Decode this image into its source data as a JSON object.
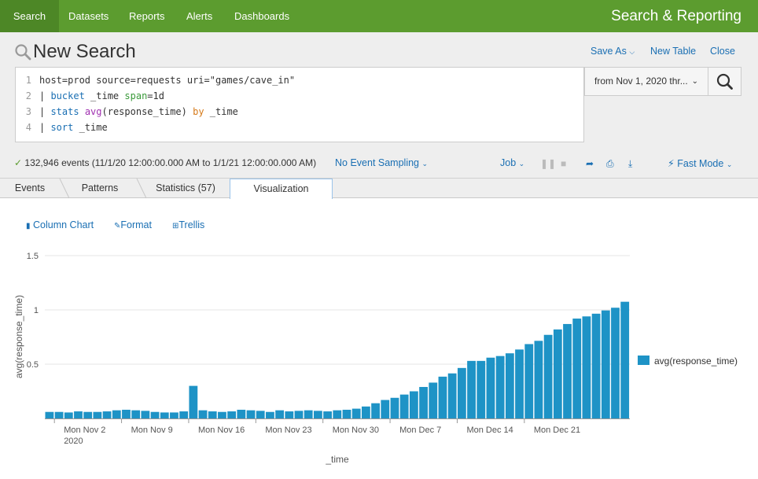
{
  "nav": {
    "items": [
      "Search",
      "Datasets",
      "Reports",
      "Alerts",
      "Dashboards"
    ],
    "app_title": "Search & Reporting"
  },
  "header": {
    "title": "New Search",
    "save_as": "Save As",
    "new_table": "New Table",
    "close": "Close"
  },
  "query": {
    "lines": [
      {
        "num": "1",
        "segments": [
          {
            "t": "host=prod source=requests uri=\"games/cave_in\"",
            "c": ""
          }
        ]
      },
      {
        "num": "2",
        "segments": [
          {
            "t": "| ",
            "c": ""
          },
          {
            "t": "bucket",
            "c": "kw-blue"
          },
          {
            "t": " _time ",
            "c": ""
          },
          {
            "t": "span",
            "c": "kw-green"
          },
          {
            "t": "=1d",
            "c": ""
          }
        ]
      },
      {
        "num": "3",
        "segments": [
          {
            "t": "| ",
            "c": ""
          },
          {
            "t": "stats",
            "c": "kw-blue"
          },
          {
            "t": " ",
            "c": ""
          },
          {
            "t": "avg",
            "c": "kw-purple"
          },
          {
            "t": "(response_time) ",
            "c": ""
          },
          {
            "t": "by",
            "c": "kw-orange"
          },
          {
            "t": " _time",
            "c": ""
          }
        ]
      },
      {
        "num": "4",
        "segments": [
          {
            "t": "| ",
            "c": ""
          },
          {
            "t": "sort",
            "c": "kw-blue"
          },
          {
            "t": " _time",
            "c": ""
          }
        ]
      }
    ]
  },
  "time_picker": {
    "label": "from Nov 1, 2020 thr..."
  },
  "status": {
    "events_text": "132,946 events (11/1/20 12:00:00.000 AM to 1/1/21 12:00:00.000 AM)",
    "sampling": "No Event Sampling",
    "job": "Job",
    "mode": "Fast Mode"
  },
  "tabs": [
    "Events",
    "Patterns",
    "Statistics (57)",
    "Visualization"
  ],
  "viz_toolbar": {
    "chart_type": "Column Chart",
    "format": "Format",
    "trellis": "Trellis"
  },
  "colors": {
    "bar": "#1e93c6",
    "nav": "#5c9c2f",
    "link": "#1a6fb3"
  },
  "chart_data": {
    "type": "bar",
    "x_start": "2020-11-01",
    "x_end": "2020-12-27",
    "xticks": [
      "Mon Nov 2",
      "Mon Nov 9",
      "Mon Nov 16",
      "Mon Nov 23",
      "Mon Nov 30",
      "Mon Dec 7",
      "Mon Dec 14",
      "Mon Dec 21"
    ],
    "xtick_year": "2020",
    "xlabel": "_time",
    "ylabel": "avg(response_time)",
    "ylim": [
      0,
      1.5
    ],
    "yticks": [
      "0.5",
      "1",
      "1.5"
    ],
    "legend": "avg(response_time)",
    "legend_position": "right",
    "values": [
      0.06,
      0.06,
      0.055,
      0.065,
      0.06,
      0.06,
      0.065,
      0.075,
      0.08,
      0.075,
      0.07,
      0.06,
      0.055,
      0.055,
      0.065,
      0.3,
      0.075,
      0.065,
      0.06,
      0.065,
      0.08,
      0.075,
      0.07,
      0.06,
      0.075,
      0.065,
      0.07,
      0.075,
      0.07,
      0.065,
      0.075,
      0.08,
      0.09,
      0.11,
      0.14,
      0.17,
      0.19,
      0.22,
      0.25,
      0.29,
      0.33,
      0.385,
      0.415,
      0.465,
      0.53,
      0.53,
      0.56,
      0.575,
      0.6,
      0.635,
      0.685,
      0.715,
      0.77,
      0.82,
      0.87,
      0.92,
      0.94,
      0.965,
      0.995,
      1.02,
      1.075
    ]
  }
}
